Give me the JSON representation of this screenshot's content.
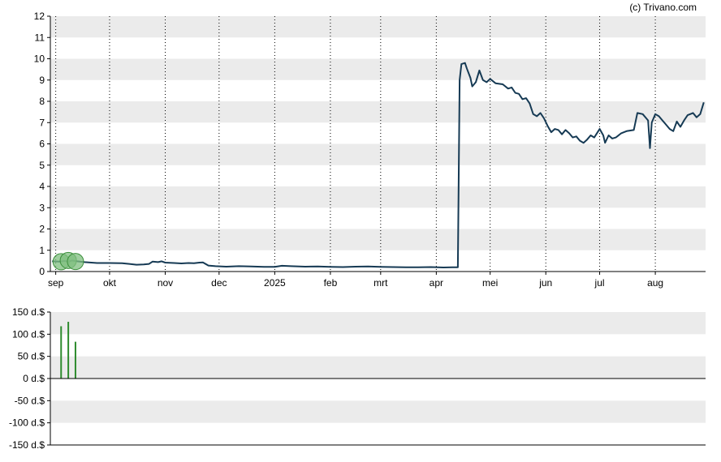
{
  "credit": "(c) Trivano.com",
  "colors": {
    "band": "#ebebeb",
    "price_line": "#163a54",
    "volume_bar": "#2e8b2e",
    "marker_fill": "#7fbf7f",
    "marker_stroke": "#3c8f3c",
    "axis": "#000000",
    "grid": "#000000"
  },
  "chart_data": [
    {
      "type": "line",
      "title": "",
      "xlabel": "",
      "ylabel": "",
      "ylim": [
        0,
        12
      ],
      "yticks": [
        0,
        1,
        2,
        3,
        4,
        5,
        6,
        7,
        8,
        9,
        10,
        11,
        12
      ],
      "ytick_labels": [
        "0",
        "1",
        "2",
        "3",
        "4",
        "5",
        "6",
        "7",
        "8",
        "9",
        "10",
        "11",
        "12"
      ],
      "xlim": [
        "2024-08-29",
        "2025-08-29"
      ],
      "xticks": [
        {
          "date": "2024-09-01",
          "label": "sep"
        },
        {
          "date": "2024-10-01",
          "label": "okt"
        },
        {
          "date": "2024-11-01",
          "label": "nov"
        },
        {
          "date": "2024-12-01",
          "label": "dec"
        },
        {
          "date": "2025-01-01",
          "label": "2025"
        },
        {
          "date": "2025-02-01",
          "label": "feb"
        },
        {
          "date": "2025-03-01",
          "label": "mrt"
        },
        {
          "date": "2025-04-01",
          "label": "apr"
        },
        {
          "date": "2025-05-01",
          "label": "mei"
        },
        {
          "date": "2025-06-01",
          "label": "jun"
        },
        {
          "date": "2025-07-01",
          "label": "jul"
        },
        {
          "date": "2025-08-01",
          "label": "aug"
        }
      ],
      "grid": "vertical dotted lines at month ticks, alternating horizontal bands",
      "series": [
        {
          "points": [
            [
              "2024-08-30",
              0.48
            ],
            [
              "2024-09-03",
              0.47
            ],
            [
              "2024-09-06",
              0.5
            ],
            [
              "2024-09-08",
              0.46
            ],
            [
              "2024-09-10",
              0.52
            ],
            [
              "2024-09-13",
              0.48
            ],
            [
              "2024-09-17",
              0.44
            ],
            [
              "2024-09-24",
              0.4
            ],
            [
              "2024-10-01",
              0.4
            ],
            [
              "2024-10-08",
              0.39
            ],
            [
              "2024-10-12",
              0.36
            ],
            [
              "2024-10-16",
              0.32
            ],
            [
              "2024-10-20",
              0.33
            ],
            [
              "2024-10-23",
              0.36
            ],
            [
              "2024-10-25",
              0.47
            ],
            [
              "2024-10-28",
              0.44
            ],
            [
              "2024-10-30",
              0.48
            ],
            [
              "2024-11-01",
              0.42
            ],
            [
              "2024-11-06",
              0.4
            ],
            [
              "2024-11-10",
              0.38
            ],
            [
              "2024-11-14",
              0.4
            ],
            [
              "2024-11-17",
              0.39
            ],
            [
              "2024-11-20",
              0.42
            ],
            [
              "2024-11-22",
              0.43
            ],
            [
              "2024-11-25",
              0.28
            ],
            [
              "2024-11-29",
              0.25
            ],
            [
              "2024-12-05",
              0.23
            ],
            [
              "2024-12-12",
              0.25
            ],
            [
              "2024-12-19",
              0.24
            ],
            [
              "2024-12-26",
              0.22
            ],
            [
              "2025-01-01",
              0.22
            ],
            [
              "2025-01-05",
              0.27
            ],
            [
              "2025-01-10",
              0.25
            ],
            [
              "2025-01-18",
              0.23
            ],
            [
              "2025-01-25",
              0.24
            ],
            [
              "2025-02-01",
              0.22
            ],
            [
              "2025-02-08",
              0.21
            ],
            [
              "2025-02-15",
              0.23
            ],
            [
              "2025-02-22",
              0.24
            ],
            [
              "2025-03-01",
              0.22
            ],
            [
              "2025-03-08",
              0.21
            ],
            [
              "2025-03-15",
              0.2
            ],
            [
              "2025-03-22",
              0.2
            ],
            [
              "2025-03-29",
              0.21
            ],
            [
              "2025-04-05",
              0.19
            ],
            [
              "2025-04-10",
              0.2
            ],
            [
              "2025-04-13",
              0.2
            ],
            [
              "2025-04-14",
              9.0
            ],
            [
              "2025-04-15",
              9.75
            ],
            [
              "2025-04-17",
              9.8
            ],
            [
              "2025-04-18",
              9.55
            ],
            [
              "2025-04-20",
              9.1
            ],
            [
              "2025-04-21",
              8.7
            ],
            [
              "2025-04-23",
              8.9
            ],
            [
              "2025-04-25",
              9.45
            ],
            [
              "2025-04-27",
              9.0
            ],
            [
              "2025-04-29",
              8.9
            ],
            [
              "2025-05-01",
              9.05
            ],
            [
              "2025-05-04",
              8.85
            ],
            [
              "2025-05-08",
              8.8
            ],
            [
              "2025-05-11",
              8.6
            ],
            [
              "2025-05-13",
              8.65
            ],
            [
              "2025-05-15",
              8.4
            ],
            [
              "2025-05-17",
              8.35
            ],
            [
              "2025-05-19",
              8.1
            ],
            [
              "2025-05-21",
              8.15
            ],
            [
              "2025-05-23",
              7.9
            ],
            [
              "2025-05-25",
              7.4
            ],
            [
              "2025-05-27",
              7.3
            ],
            [
              "2025-05-29",
              7.45
            ],
            [
              "2025-05-31",
              7.2
            ],
            [
              "2025-06-02",
              6.85
            ],
            [
              "2025-06-04",
              6.55
            ],
            [
              "2025-06-06",
              6.7
            ],
            [
              "2025-06-08",
              6.65
            ],
            [
              "2025-06-10",
              6.45
            ],
            [
              "2025-06-12",
              6.65
            ],
            [
              "2025-06-14",
              6.5
            ],
            [
              "2025-06-16",
              6.3
            ],
            [
              "2025-06-18",
              6.35
            ],
            [
              "2025-06-20",
              6.15
            ],
            [
              "2025-06-22",
              6.05
            ],
            [
              "2025-06-24",
              6.2
            ],
            [
              "2025-06-26",
              6.4
            ],
            [
              "2025-06-28",
              6.3
            ],
            [
              "2025-07-01",
              6.7
            ],
            [
              "2025-07-03",
              6.4
            ],
            [
              "2025-07-04",
              6.05
            ],
            [
              "2025-07-06",
              6.4
            ],
            [
              "2025-07-08",
              6.25
            ],
            [
              "2025-07-10",
              6.3
            ],
            [
              "2025-07-13",
              6.5
            ],
            [
              "2025-07-16",
              6.6
            ],
            [
              "2025-07-20",
              6.65
            ],
            [
              "2025-07-22",
              7.45
            ],
            [
              "2025-07-25",
              7.4
            ],
            [
              "2025-07-27",
              7.2
            ],
            [
              "2025-07-28",
              7.1
            ],
            [
              "2025-07-29",
              5.8
            ],
            [
              "2025-07-30",
              7.0
            ],
            [
              "2025-08-01",
              7.4
            ],
            [
              "2025-08-03",
              7.3
            ],
            [
              "2025-08-05",
              7.1
            ],
            [
              "2025-08-07",
              6.9
            ],
            [
              "2025-08-09",
              6.7
            ],
            [
              "2025-08-11",
              6.6
            ],
            [
              "2025-08-13",
              7.05
            ],
            [
              "2025-08-15",
              6.8
            ],
            [
              "2025-08-17",
              7.1
            ],
            [
              "2025-08-19",
              7.35
            ],
            [
              "2025-08-22",
              7.45
            ],
            [
              "2025-08-24",
              7.25
            ],
            [
              "2025-08-26",
              7.4
            ],
            [
              "2025-08-28",
              7.95
            ]
          ]
        }
      ],
      "markers": [
        {
          "date": "2024-09-04",
          "value": 0.46
        },
        {
          "date": "2024-09-08",
          "value": 0.52
        },
        {
          "date": "2024-09-12",
          "value": 0.47
        }
      ]
    },
    {
      "type": "bar",
      "title": "",
      "xlabel": "",
      "ylabel": "",
      "ylim": [
        -150,
        150
      ],
      "yticks": [
        150,
        100,
        50,
        0,
        -50,
        -100,
        -150
      ],
      "ytick_labels": [
        "150 d.$",
        "100 d.$",
        "50 d.$",
        "0 d.$",
        "-50 d.$",
        "-100 d.$",
        "-150 d.$"
      ],
      "xlim": [
        "2024-08-29",
        "2025-08-29"
      ],
      "grid": "alternating horizontal bands, zero line",
      "bars": [
        {
          "date": "2024-09-04",
          "value": 118
        },
        {
          "date": "2024-09-08",
          "value": 128
        },
        {
          "date": "2024-09-12",
          "value": 83
        }
      ]
    }
  ]
}
